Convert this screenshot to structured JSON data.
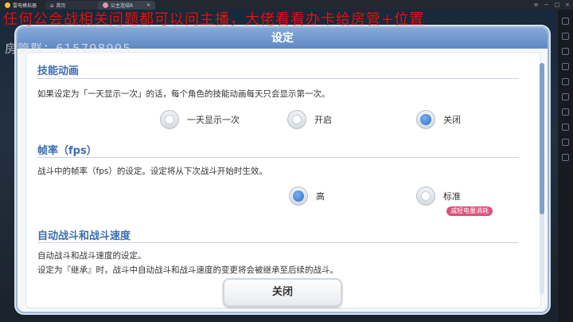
{
  "window": {
    "tabs": [
      {
        "label": "雷电模拟器"
      },
      {
        "label": "首页"
      },
      {
        "label": "公主连结R"
      }
    ]
  },
  "overlay": {
    "banner": "任何公会战相关问题都可以问主播，大佬看看办卡给房管+位置",
    "room": "房管群：615798995"
  },
  "dialog": {
    "title": "设定",
    "skill_anim": {
      "heading": "技能动画",
      "desc": "如果设定为「一天显示一次」的话，每个角色的技能动画每天只会显示第一次。",
      "options": [
        "一天显示一次",
        "开启",
        "关闭"
      ],
      "selected": "关闭"
    },
    "fps": {
      "heading": "帧率（fps）",
      "desc": "战斗中的帧率（fps）的设定。设定将从下次战斗开始时生效。",
      "options": [
        "高",
        "标准"
      ],
      "selected": "高",
      "badge": "减轻电量消耗"
    },
    "auto_battle": {
      "heading": "自动战斗和战斗速度",
      "desc1": "自动战斗和战斗速度的设定。",
      "desc2": "设定为『继承』时，战斗中自动战斗和战斗速度的变更将会被继承至后续的战斗。"
    },
    "close_label": "关闭"
  }
}
